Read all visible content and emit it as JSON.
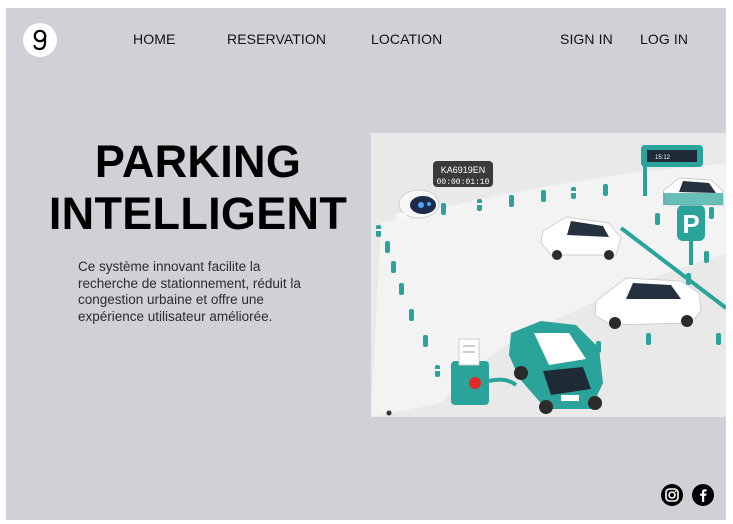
{
  "nav": {
    "links": [
      "HOME",
      "RESERVATION",
      "LOCATION"
    ],
    "sign_in": "SIGN IN",
    "log_in": "LOG IN"
  },
  "hero": {
    "title_line1": "PARKING",
    "title_line2": "INTELLIGENT",
    "description": "Ce système innovant facilite la recherche de stationnement, réduit la congestion urbaine et offre une expérience utilisateur améliorée."
  },
  "image": {
    "plate_text": "KA6919EN",
    "timer_text": "00:00:01:10",
    "sign_text": "15:12",
    "parking_letter": "P"
  },
  "icons": {
    "logo": "g-logo-icon",
    "social": [
      "instagram-icon",
      "facebook-icon"
    ]
  },
  "colors": {
    "background": "#d1d0d6",
    "teal": "#2aa39a",
    "text": "#000000"
  }
}
